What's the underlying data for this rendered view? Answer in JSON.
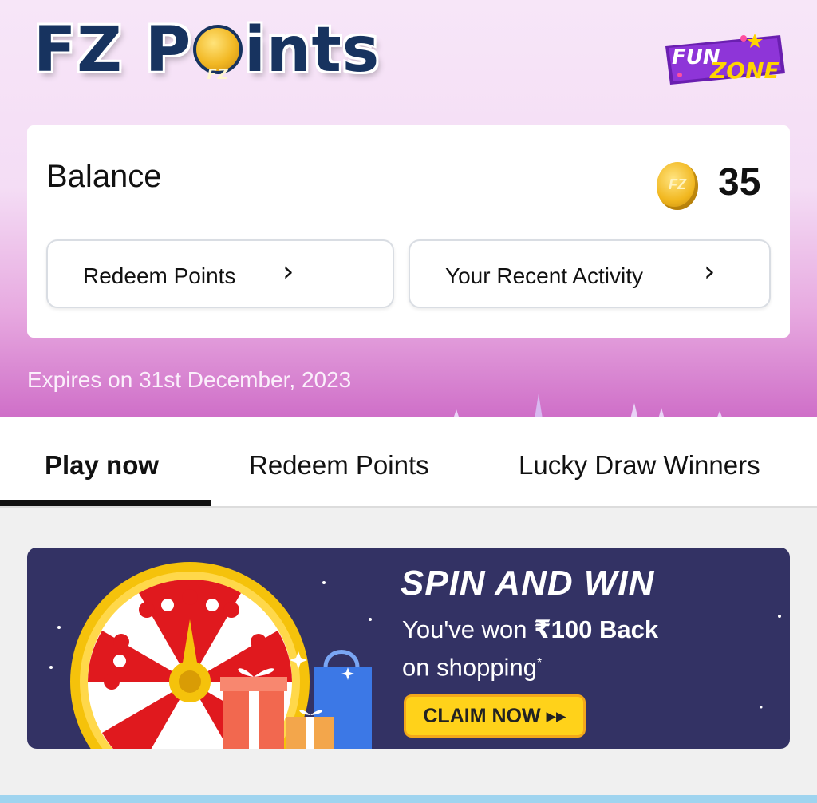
{
  "header": {
    "logo_text_before": "FZ P",
    "logo_text_after": "ints",
    "logo_coin_text": "FZ",
    "brand_badge_top": "FUN",
    "brand_badge_bottom": "ZONE"
  },
  "balance_card": {
    "label": "Balance",
    "coin_text": "FZ",
    "value": "35",
    "redeem_button": "Redeem Points",
    "activity_button": "Your Recent Activity"
  },
  "expiry": "Expires on 31st December, 2023",
  "tabs": [
    {
      "label": "Play now",
      "active": true
    },
    {
      "label": "Redeem Points",
      "active": false
    },
    {
      "label": "Lucky Draw Winners",
      "active": false
    }
  ],
  "banner": {
    "title": "SPIN AND WIN",
    "line1_prefix": "You've won ",
    "line1_bold": "₹100 Back",
    "line2": "on shopping",
    "line2_sup": "*",
    "claim_button": "CLAIM NOW ▸▸"
  },
  "colors": {
    "accent_purple": "#cf6fc8",
    "banner_bg": "#333264",
    "claim_yellow": "#ffd21a",
    "logo_navy": "#17335f"
  }
}
